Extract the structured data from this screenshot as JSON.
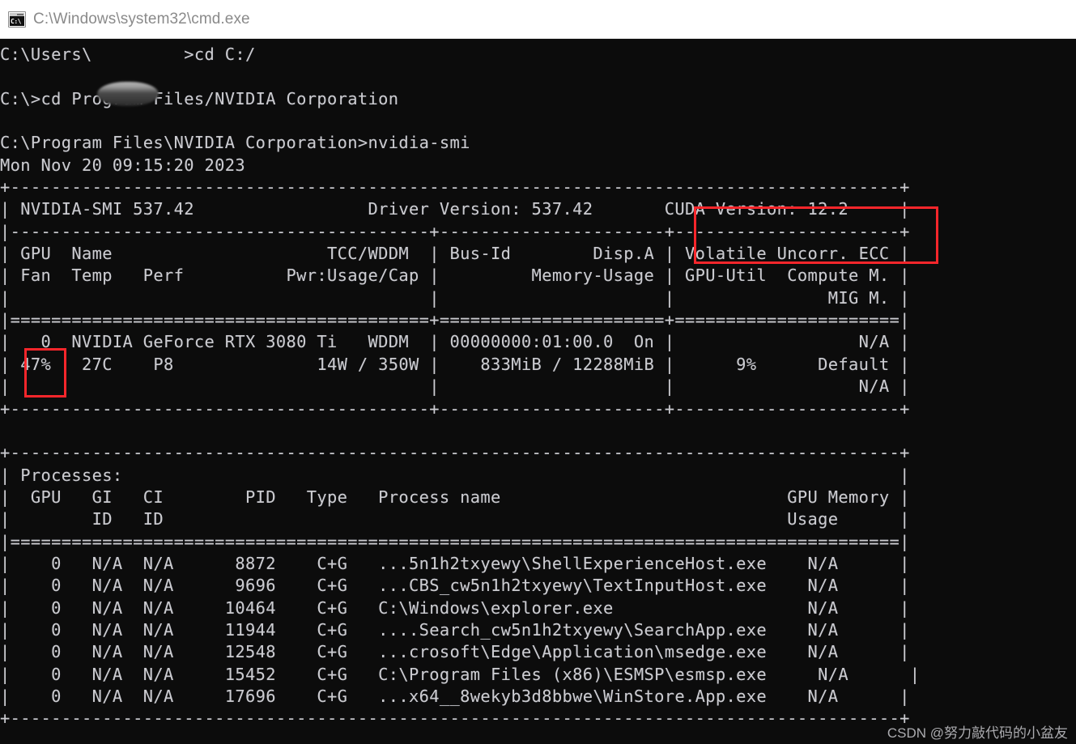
{
  "window": {
    "title": "C:\\Windows\\system32\\cmd.exe",
    "icon": "cmd-console-icon",
    "icon_glyph": "C:\\",
    "titlebar_bg": "#ffffff",
    "titlebar_text_color": "#8a8a8a"
  },
  "console": {
    "background": "#0c0c0c",
    "foreground": "#ccccd0",
    "lines": [
      "C:\\Users\\         >cd C:/",
      "",
      "C:\\>cd Program Files/NVIDIA Corporation",
      "",
      "C:\\Program Files\\NVIDIA Corporation>nvidia-smi",
      "Mon Nov 20 09:15:20 2023",
      "+---------------------------------------------------------------------------------------+",
      "| NVIDIA-SMI 537.42                 Driver Version: 537.42       CUDA Version: 12.2     |",
      "|-----------------------------------------+----------------------+----------------------+",
      "| GPU  Name                     TCC/WDDM  | Bus-Id        Disp.A | Volatile Uncorr. ECC |",
      "| Fan  Temp   Perf          Pwr:Usage/Cap |         Memory-Usage | GPU-Util  Compute M. |",
      "|                                         |                      |               MIG M. |",
      "|=========================================+======================+======================|",
      "|   0  NVIDIA GeForce RTX 3080 Ti   WDDM  | 00000000:01:00.0  On |                  N/A |",
      "| 47%   27C    P8              14W / 350W |    833MiB / 12288MiB |      9%      Default |",
      "|                                         |                      |                  N/A |",
      "+-----------------------------------------+----------------------+----------------------+",
      "",
      "+---------------------------------------------------------------------------------------+",
      "| Processes:                                                                            |",
      "|  GPU   GI   CI        PID   Type   Process name                            GPU Memory |",
      "|        ID   ID                                                             Usage      |",
      "|=======================================================================================|",
      "|    0   N/A  N/A      8872    C+G   ...5n1h2txyewy\\ShellExperienceHost.exe    N/A      |",
      "|    0   N/A  N/A      9696    C+G   ...CBS_cw5n1h2txyewy\\TextInputHost.exe    N/A      |",
      "|    0   N/A  N/A     10464    C+G   C:\\Windows\\explorer.exe                   N/A      |",
      "|    0   N/A  N/A     11944    C+G   ....Search_cw5n1h2txyewy\\SearchApp.exe    N/A      |",
      "|    0   N/A  N/A     12548    C+G   ...crosoft\\Edge\\Application\\msedge.exe    N/A      |",
      "|    0   N/A  N/A     15452    C+G   C:\\Program Files (x86)\\ESMSP\\esmsp.exe     N/A      |",
      "|    0   N/A  N/A     17696    C+G   ...x64__8wekyb3d8bbwe\\WinStore.App.exe    N/A      |",
      "+---------------------------------------------------------------------------------------+"
    ]
  },
  "commands": [
    {
      "prompt": "C:\\Users\\         >",
      "text": "cd C:/"
    },
    {
      "prompt": "C:\\>",
      "text": "cd Program Files/NVIDIA Corporation"
    },
    {
      "prompt": "C:\\Program Files\\NVIDIA Corporation>",
      "text": "nvidia-smi"
    }
  ],
  "nvidia_smi": {
    "timestamp": "Mon Nov 20 09:15:20 2023",
    "smi_version": "NVIDIA-SMI 537.42",
    "driver_version": "Driver Version: 537.42",
    "cuda_version": "CUDA Version: 12.2",
    "gpu_table_headers_row1": [
      "GPU",
      "Name",
      "TCC/WDDM",
      "Bus-Id",
      "Disp.A",
      "Volatile Uncorr. ECC"
    ],
    "gpu_table_headers_row2": [
      "Fan",
      "Temp",
      "Perf",
      "Pwr:Usage/Cap",
      "Memory-Usage",
      "GPU-Util",
      "Compute M."
    ],
    "gpu_table_headers_row3": [
      "MIG M."
    ],
    "gpus": [
      {
        "index": "0",
        "name": "NVIDIA GeForce RTX 3080 Ti",
        "mode": "WDDM",
        "bus_id": "00000000:01:00.0",
        "disp_a": "On",
        "ecc": "N/A",
        "fan": "47%",
        "temp": "27C",
        "perf": "P8",
        "power": "14W / 350W",
        "memory": "833MiB / 12288MiB",
        "gpu_util": "9%",
        "compute_mode": "Default",
        "mig_mode": "N/A"
      }
    ],
    "processes_title": "Processes:",
    "process_headers": [
      "GPU",
      "GI",
      "CI",
      "PID",
      "Type",
      "Process name",
      "GPU Memory"
    ],
    "process_subheaders": [
      "ID",
      "ID",
      "Usage"
    ],
    "processes": [
      {
        "gpu": "0",
        "gi_id": "N/A",
        "ci_id": "N/A",
        "pid": "8872",
        "type": "C+G",
        "name": "...5n1h2txyewy\\ShellExperienceHost.exe",
        "memory": "N/A"
      },
      {
        "gpu": "0",
        "gi_id": "N/A",
        "ci_id": "N/A",
        "pid": "9696",
        "type": "C+G",
        "name": "...CBS_cw5n1h2txyewy\\TextInputHost.exe",
        "memory": "N/A"
      },
      {
        "gpu": "0",
        "gi_id": "N/A",
        "ci_id": "N/A",
        "pid": "10464",
        "type": "C+G",
        "name": "C:\\Windows\\explorer.exe",
        "memory": "N/A"
      },
      {
        "gpu": "0",
        "gi_id": "N/A",
        "ci_id": "N/A",
        "pid": "11944",
        "type": "C+G",
        "name": "....Search_cw5n1h2txyewy\\SearchApp.exe",
        "memory": "N/A"
      },
      {
        "gpu": "0",
        "gi_id": "N/A",
        "ci_id": "N/A",
        "pid": "12548",
        "type": "C+G",
        "name": "...crosoft\\Edge\\Application\\msedge.exe",
        "memory": "N/A"
      },
      {
        "gpu": "0",
        "gi_id": "N/A",
        "ci_id": "N/A",
        "pid": "15452",
        "type": "C+G",
        "name": "C:\\Program Files (x86)\\ESMSP\\esmsp.exe",
        "memory": "N/A"
      },
      {
        "gpu": "0",
        "gi_id": "N/A",
        "ci_id": "N/A",
        "pid": "17696",
        "type": "C+G",
        "name": "...x64__8wekyb3d8bbwe\\WinStore.App.exe",
        "memory": "N/A"
      }
    ]
  },
  "annotations": {
    "color": "#f8262b",
    "boxes": [
      {
        "name": "cuda-version-highlight",
        "target": "CUDA Version: 12.2"
      },
      {
        "name": "gpu-index-highlight",
        "target": "0"
      }
    ]
  },
  "watermark": {
    "text": "CSDN @努力敲代码的小盆友"
  }
}
